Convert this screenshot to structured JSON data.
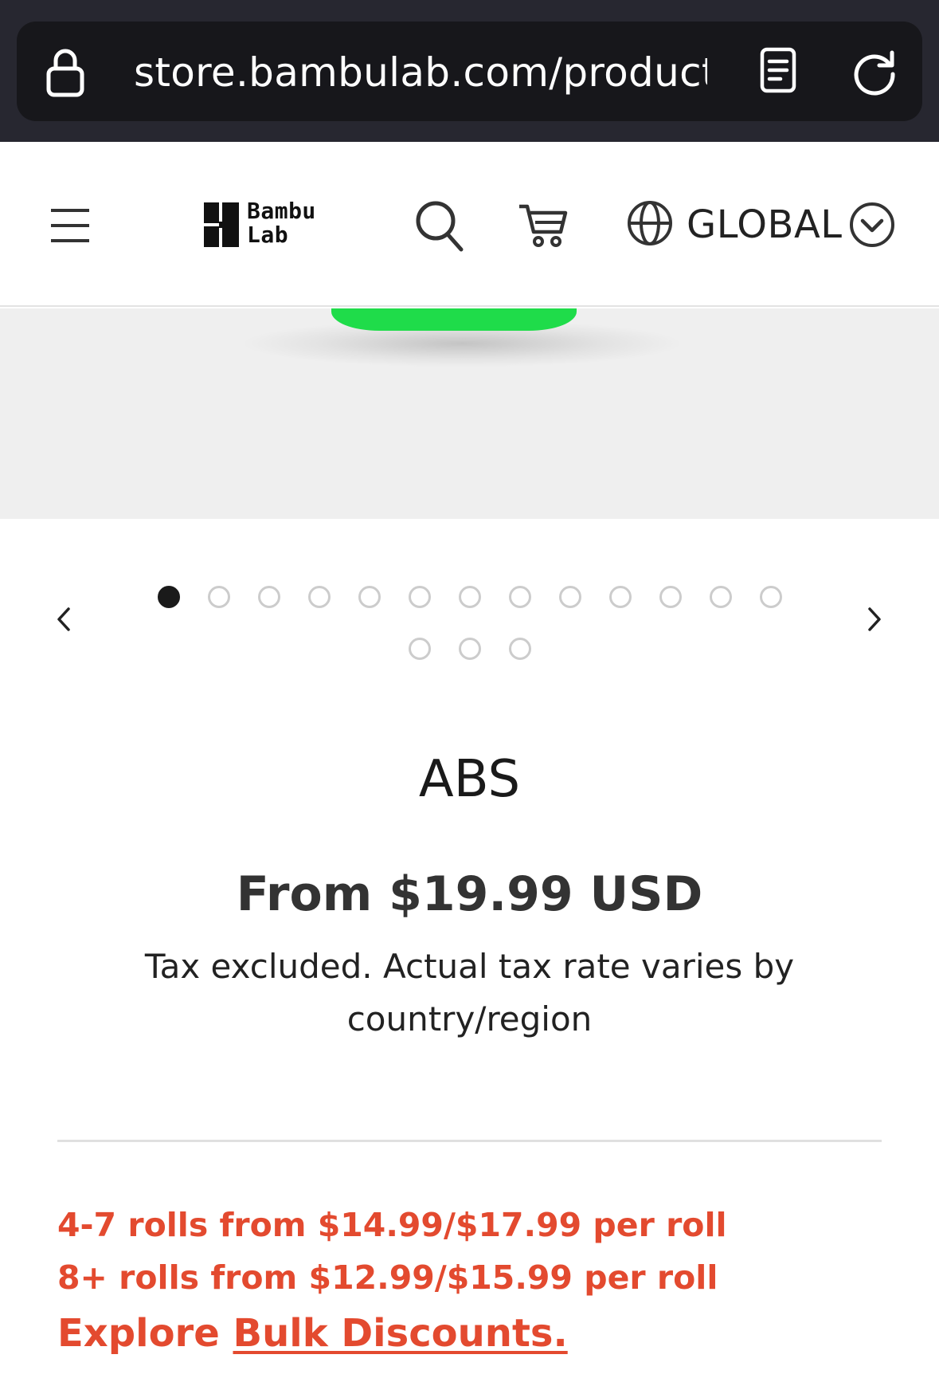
{
  "browser": {
    "url": "store.bambulab.com/product…"
  },
  "header": {
    "logo_text_line1": "Bambu",
    "logo_text_line2": "Lab",
    "region_label": "GLOBAL"
  },
  "carousel": {
    "total_images": 16,
    "active_index": 0
  },
  "product": {
    "title": "ABS",
    "price": "From $19.99 USD",
    "tax_note": "Tax excluded. Actual tax rate varies by country/region"
  },
  "bulk": {
    "line1": "4-7 rolls from $14.99/$17.99 per roll",
    "line2": "8+ rolls from $12.99/$15.99 per roll",
    "explore_prefix": "Explore ",
    "explore_link": "Bulk Discounts."
  },
  "colors": {
    "browser_bg": "#272730",
    "accent_red": "#e34a2f",
    "product_green": "#1fdc4a"
  }
}
